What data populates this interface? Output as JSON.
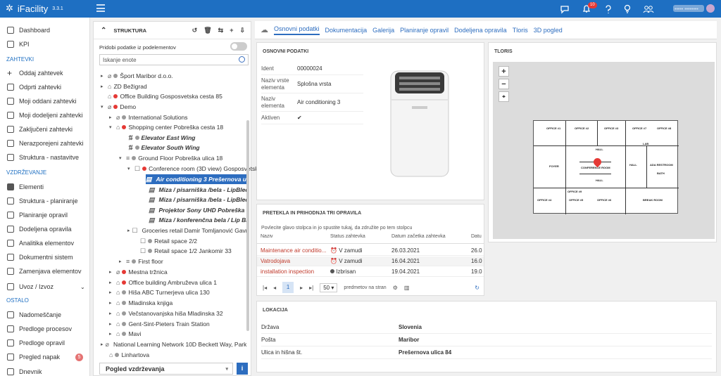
{
  "app": {
    "name": "iFacility",
    "version": "3.3.1",
    "notif_count": "10",
    "user_name": "••••• ••••••••"
  },
  "sidebar": {
    "items": [
      {
        "label": "Dashboard"
      },
      {
        "label": "KPI"
      },
      {
        "label": "Oddaj zahtevek"
      },
      {
        "label": "Odprti zahtevki"
      },
      {
        "label": "Moji oddani zahtevki"
      },
      {
        "label": "Moji dodeljeni zahtevki"
      },
      {
        "label": "Zaključeni zahtevki"
      },
      {
        "label": "Nerazporejeni zahtevki"
      },
      {
        "label": "Struktura - nastavitve"
      },
      {
        "label": "Elementi"
      },
      {
        "label": "Struktura - planiranje"
      },
      {
        "label": "Planiranje opravil"
      },
      {
        "label": "Dodeljena opravila"
      },
      {
        "label": "Analitika elementov"
      },
      {
        "label": "Dokumentni sistem"
      },
      {
        "label": "Zamenjava elementov"
      },
      {
        "label": "Uvoz / Izvoz"
      },
      {
        "label": "Nadomeščanje"
      },
      {
        "label": "Predloge procesov"
      },
      {
        "label": "Predloge opravil"
      },
      {
        "label": "Pregled napak"
      },
      {
        "label": "Dnevnik"
      }
    ],
    "sections": [
      "ZAHTEVKI",
      "VZDRŽEVANJE",
      "OSTALO"
    ],
    "napake_badge": "5"
  },
  "tree": {
    "title": "STRUKTURA",
    "toggle_label": "Pridobi podatke iz podelementov",
    "search_placeholder": "Iskanje enote",
    "nodes": [
      "Šport Maribor d.o.o.",
      "ZD Bežigrad",
      "Office Building Gosposvetska cesta 85",
      "Demo",
      "International Solutions",
      "Shopping center Pobreška cesta 18",
      "Elevator East Wing",
      "Elevator South Wing",
      "Ground Floor Pobreška ulica 18",
      "Conference room (3D view) Gosposvetska",
      "Air conditioning 3 Prešernova ulica",
      "Miza / pisarniška /bela - LipBled",
      "Miza / pisarniška /bela - LipBled",
      "Projektor Sony UHD Pobreška cesta",
      "Miza / konferenčna bela / Lip Bled",
      "Groceries retail Damir Tomljanović Gavran",
      "Retail space 2/2",
      "Retail space 1/2 Jankomir 33",
      "First floor",
      "Mestna tržnica",
      "Office building Ambruževa ulica 1",
      "Hiša ABC Turnerjeva ulica 130",
      "Mladinska knjiga",
      "Večstanovanjska hiša Mladinska 32",
      "Gent-Sint-Pieters Train Station",
      "Mavi",
      "National Learning Network 10D Beckett Way, Park West",
      "Linhartova"
    ],
    "bottom_select": "Pogled vzdrževanja"
  },
  "tabs": [
    "Osnovni podatki",
    "Dokumentacija",
    "Galerija",
    "Planiranje opravil",
    "Dodeljena opravila",
    "Tloris",
    "3D pogled"
  ],
  "basic": {
    "title": "OSNOVNI PODATKI",
    "rows": [
      {
        "k": "Ident",
        "v": "00000024"
      },
      {
        "k": "Naziv vrste elementa",
        "v": "Splošna vrsta"
      },
      {
        "k": "Naziv elementa",
        "v": "Air conditioning 3"
      },
      {
        "k": "Aktiven",
        "v": "✔"
      }
    ]
  },
  "tasks": {
    "title": "PRETEKLA IN PRIHODNJA TRI OPRAVILA",
    "hint": "Povlecite glavo stolpca in jo spustite tukaj, da združite po tem stolpcu",
    "cols": [
      "Naziv",
      "Status zahtevka",
      "Datum začetka zahtevka",
      "Datu"
    ],
    "rows": [
      {
        "n": "Maintenance air conditio...",
        "s": "V zamudi",
        "d": "26.03.2021",
        "e": "26.0"
      },
      {
        "n": "Vatrodojava",
        "s": "V zamudi",
        "d": "16.04.2021",
        "e": "16.0"
      },
      {
        "n": "installation inspection",
        "s": "Izbrisan",
        "d": "19.04.2021",
        "e": "19.0"
      }
    ],
    "page": "1",
    "page_size": "50",
    "per_page_label": "predmetov na stran"
  },
  "floor": {
    "title": "TLORIS",
    "rooms": [
      "OFFICE #1",
      "OFFICE #2",
      "OFFICE #3",
      "OFFICE #4",
      "OFFICE #5",
      "OFFICE #6",
      "OFFICE #7",
      "OFFICE #8",
      "OFFICE #9",
      "HALL",
      "HALL",
      "HALL",
      "LAB",
      "FOYER",
      "CONFERENCE ROOM",
      "BREAK ROOM",
      "ADA RESTROOM",
      "BATH"
    ]
  },
  "location": {
    "title": "LOKACIJA",
    "rows": [
      {
        "k": "Država",
        "v": "Slovenia"
      },
      {
        "k": "Pošta",
        "v": "Maribor"
      },
      {
        "k": "Ulica in hišna št.",
        "v": "Prešernova ulica 84"
      }
    ]
  }
}
